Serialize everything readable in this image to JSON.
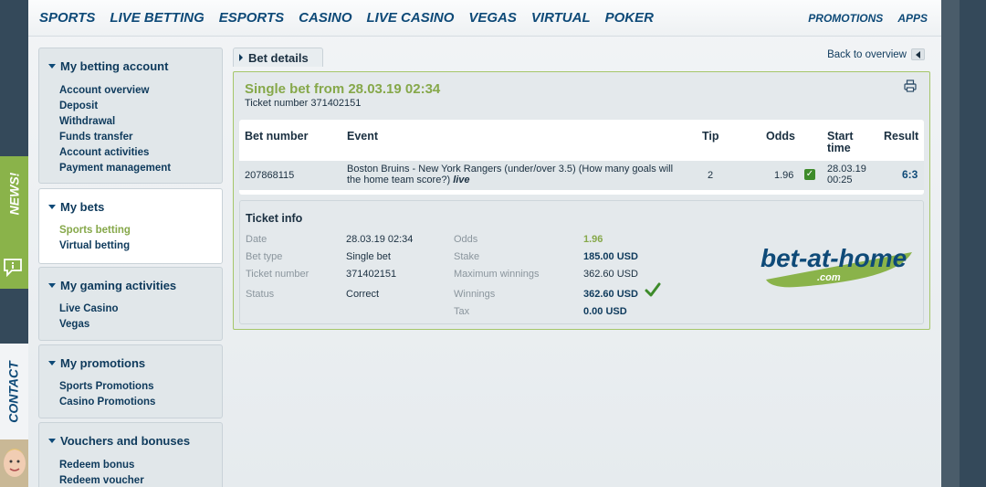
{
  "top_nav": {
    "main": [
      "SPORTS",
      "LIVE BETTING",
      "ESPORTS",
      "CASINO",
      "LIVE CASINO",
      "VEGAS",
      "VIRTUAL",
      "POKER"
    ],
    "right": [
      "PROMOTIONS",
      "APPS"
    ]
  },
  "sidebar": {
    "sections": [
      {
        "title": "My betting account",
        "items": [
          "Account overview",
          "Deposit",
          "Withdrawal",
          "Funds transfer",
          "Account activities",
          "Payment management"
        ]
      },
      {
        "title": "My bets",
        "items": [
          "Sports betting",
          "Virtual betting"
        ],
        "current": "Sports betting"
      },
      {
        "title": "My gaming activities",
        "items": [
          "Live Casino",
          "Vegas"
        ]
      },
      {
        "title": "My promotions",
        "items": [
          "Sports Promotions",
          "Casino Promotions"
        ]
      },
      {
        "title": "Vouchers and bonuses",
        "items": [
          "Redeem bonus",
          "Redeem voucher"
        ]
      }
    ]
  },
  "side_tabs": {
    "news": "NEWS!",
    "contact": "CONTACT"
  },
  "bet_details": {
    "tab_label": "Bet details",
    "back_label": "Back to overview",
    "title": "Single bet from 28.03.19 02:34",
    "ticket_number_line": "Ticket number 371402151",
    "table": {
      "headers": {
        "bet_number": "Bet number",
        "event": "Event",
        "tip": "Tip",
        "odds": "Odds",
        "start_time_1": "Start",
        "start_time_2": "time",
        "result": "Result"
      },
      "row": {
        "bet_number": "207868115",
        "event_line1": "Boston Bruins - New York Rangers (under/over 3.5) (How many goals will",
        "event_line2": "the home team score?)",
        "live": "live",
        "tip": "2",
        "odds": "1.96",
        "start_date": "28.03.19",
        "start_time": "00:25",
        "result": "6:3"
      }
    },
    "ticket_info": {
      "title": "Ticket info",
      "left": [
        {
          "label": "Date",
          "value": "28.03.19 02:34"
        },
        {
          "label": "Bet type",
          "value": "Single bet"
        },
        {
          "label": "Ticket number",
          "value": "371402151"
        },
        {
          "label": "Status",
          "value": "Correct"
        }
      ],
      "right": [
        {
          "label": "Odds",
          "value": "1.96"
        },
        {
          "label": "Stake",
          "value": "185.00 USD"
        },
        {
          "label": "Maximum winnings",
          "value": "362.60 USD"
        },
        {
          "label": "Winnings",
          "value": "362.60 USD"
        },
        {
          "label": "Tax",
          "value": "0.00 USD"
        }
      ],
      "logo_text": "bet-at-home",
      "logo_sub": ".com"
    }
  },
  "colors": {
    "brand_blue": "#0e4a78",
    "accent_green": "#86a84a",
    "check_green": "#3d8b2a"
  }
}
